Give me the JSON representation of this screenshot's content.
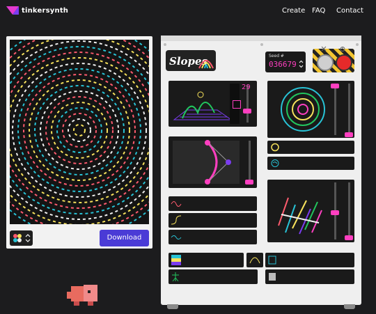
{
  "header": {
    "brand": "tinkersynth",
    "nav": [
      {
        "label": "Create"
      },
      {
        "label": "FAQ"
      },
      {
        "label": "Contact"
      }
    ]
  },
  "preview": {
    "download_label": "Download"
  },
  "machine": {
    "title": "Slopes",
    "seed_label": "Seed #",
    "seed_value": "036679",
    "perspective_value": "29"
  },
  "colors": {
    "accent": "#ff3fc0",
    "download": "#4a3bd6",
    "seed": "#ff3fc0",
    "background": "#1c1c1e"
  }
}
